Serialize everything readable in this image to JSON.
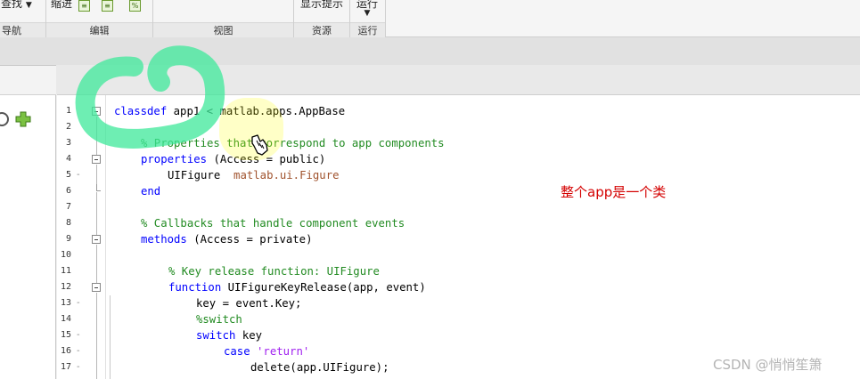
{
  "toolstrip": {
    "sections": [
      {
        "id": "nav",
        "label": "导航",
        "buttons": [
          {
            "label": "查找",
            "has_dropdown": true
          }
        ]
      },
      {
        "id": "edit",
        "label": "编辑",
        "buttons": [
          {
            "label": "缩进"
          }
        ]
      },
      {
        "id": "view",
        "label": "视图",
        "buttons": []
      },
      {
        "id": "resources",
        "label": "资源",
        "buttons": [
          {
            "label": "显示提示"
          }
        ]
      },
      {
        "id": "run",
        "label": "运行",
        "buttons": [
          {
            "label": "运行",
            "has_dropdown": true
          }
        ]
      }
    ]
  },
  "editor": {
    "lines": [
      {
        "num": "1",
        "dash": "",
        "fold": "box"
      },
      {
        "num": "2",
        "dash": "",
        "fold": ""
      },
      {
        "num": "3",
        "dash": "",
        "fold": ""
      },
      {
        "num": "4",
        "dash": "",
        "fold": "box"
      },
      {
        "num": "5",
        "dash": "-",
        "fold": ""
      },
      {
        "num": "6",
        "dash": "",
        "fold": "end"
      },
      {
        "num": "7",
        "dash": "",
        "fold": ""
      },
      {
        "num": "8",
        "dash": "",
        "fold": ""
      },
      {
        "num": "9",
        "dash": "",
        "fold": "box"
      },
      {
        "num": "10",
        "dash": "",
        "fold": ""
      },
      {
        "num": "11",
        "dash": "",
        "fold": ""
      },
      {
        "num": "12",
        "dash": "",
        "fold": "box"
      },
      {
        "num": "13",
        "dash": "-",
        "fold": ""
      },
      {
        "num": "14",
        "dash": "",
        "fold": ""
      },
      {
        "num": "15",
        "dash": "-",
        "fold": ""
      },
      {
        "num": "16",
        "dash": "-",
        "fold": ""
      },
      {
        "num": "17",
        "dash": "-",
        "fold": ""
      }
    ],
    "code": {
      "l1": {
        "kw": "classdef",
        "rest": " app1 < matlab.apps.AppBase"
      },
      "l3": {
        "comment": "% Properties that correspond to app components"
      },
      "l4": {
        "kw": "properties",
        "rest": " (Access = public)"
      },
      "l5": {
        "name": "UIFigure",
        "type": "matlab.ui.Figure"
      },
      "l6": {
        "kw": "end"
      },
      "l8": {
        "comment": "% Callbacks that handle component events"
      },
      "l9": {
        "kw": "methods",
        "rest": " (Access = private)"
      },
      "l11": {
        "comment": "% Key release function: UIFigure"
      },
      "l12": {
        "kw": "function",
        "rest": " UIFigureKeyRelease(app, event)"
      },
      "l13": {
        "text": "key = event.Key;"
      },
      "l14": {
        "comment": "%switch"
      },
      "l15": {
        "kw": "switch",
        "rest": " key"
      },
      "l16": {
        "kw": "case",
        "string": "'return'"
      },
      "l17": {
        "text": "delete(app.UIFigure);"
      }
    }
  },
  "annotation": "整个app是一个类",
  "watermark": "CSDN @悄悄笙箫",
  "colors": {
    "keyword": "#0000ff",
    "comment": "#228b22",
    "string": "#a020f0",
    "type": "#a0522d",
    "annotation": "#d40000",
    "scribble": "#3de89a"
  },
  "icons": [
    "indent-icon",
    "outdent-icon",
    "comment-icon",
    "search-circle-icon",
    "add-plus-icon",
    "hand-cursor-icon"
  ]
}
